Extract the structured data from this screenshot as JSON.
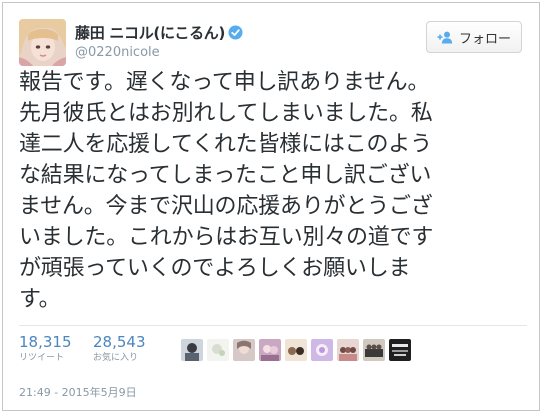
{
  "user": {
    "display_name": "藤田 ニコル(にこるん)",
    "handle": "@0220nicole",
    "verified_icon": "verified-badge-icon"
  },
  "follow_button": {
    "label": "フォロー",
    "icon": "add-user-icon"
  },
  "tweet": {
    "lines": [
      "報告です。遅くなって申し訳ありません。",
      "先月彼氏とはお別れしてしまいました。私",
      "達二人を応援してくれた皆様にはこのよう",
      "な結果になってしまったこと申し訳ござい",
      "ません。今まで沢山の応援ありがとうござ",
      "いました。これからはお互い別々の道です",
      "が頑張っていくのでよろしくお願いしま",
      "す。"
    ]
  },
  "stats": {
    "retweets": {
      "value": "18,315",
      "label": "リツイート"
    },
    "favorites": {
      "value": "28,543",
      "label": "お気に入り"
    }
  },
  "timestamp": "21:49 - 2015年5月9日",
  "colors": {
    "link": "#4b86bf",
    "text": "#292f33",
    "muted": "#8899a6",
    "verified": "#55acee"
  }
}
